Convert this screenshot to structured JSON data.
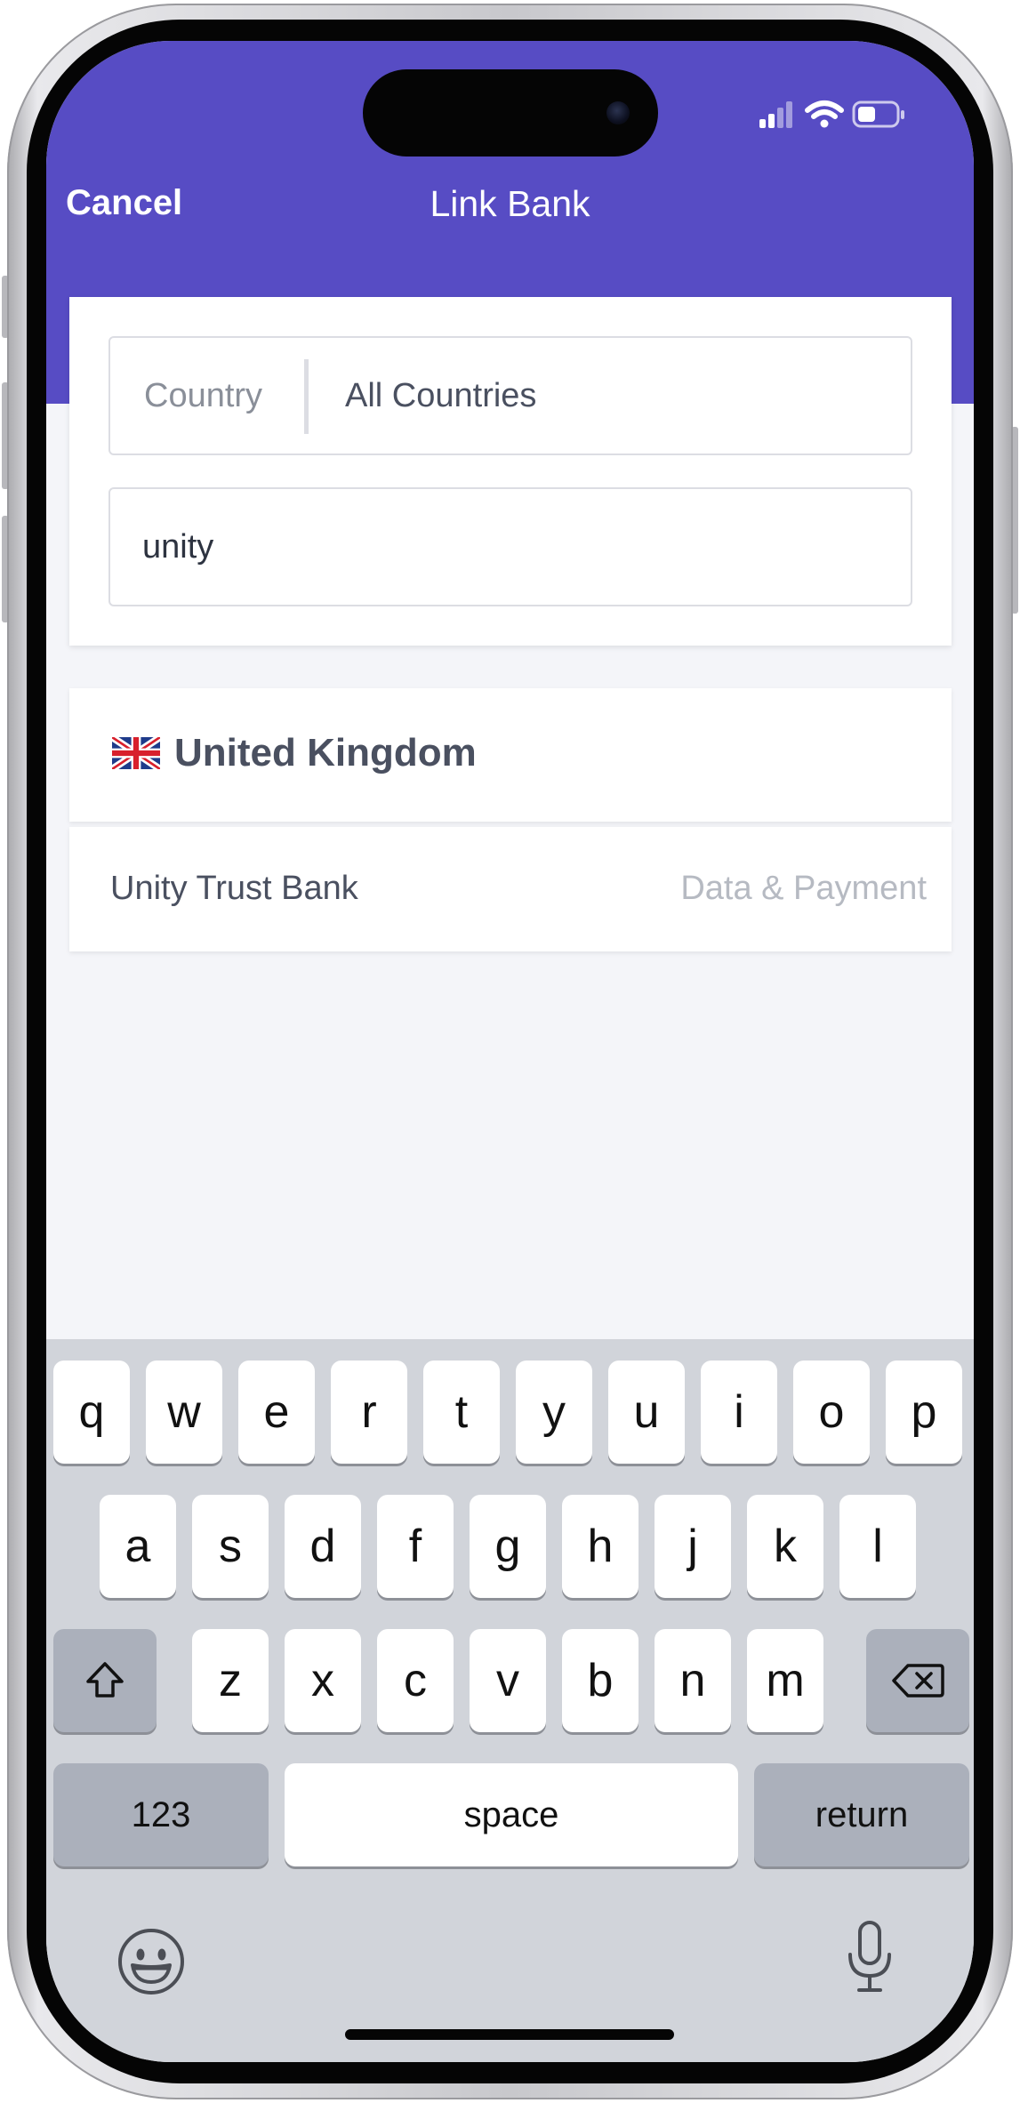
{
  "navbar": {
    "cancel_label": "Cancel",
    "title": "Link Bank"
  },
  "search": {
    "country_label": "Country",
    "country_value": "All Countries",
    "query_value": "unity"
  },
  "results": {
    "group": {
      "flag": "🇬🇧",
      "flag_icon": "uk-flag-icon",
      "country": "United Kingdom"
    },
    "items": [
      {
        "name": "Unity Trust Bank",
        "type": "Data & Payment"
      }
    ]
  },
  "keyboard": {
    "row1": [
      "q",
      "w",
      "e",
      "r",
      "t",
      "y",
      "u",
      "i",
      "o",
      "p"
    ],
    "row2": [
      "a",
      "s",
      "d",
      "f",
      "g",
      "h",
      "j",
      "k",
      "l"
    ],
    "row3": [
      "z",
      "x",
      "c",
      "v",
      "b",
      "n",
      "m"
    ],
    "numbers_label": "123",
    "space_label": "space",
    "return_label": "return",
    "shift_icon": "shift-icon",
    "backspace_icon": "backspace-icon",
    "emoji_icon": "emoji-icon",
    "mic_icon": "microphone-icon"
  },
  "status_bar": {
    "signal_icon": "cellular-signal-icon",
    "wifi_icon": "wifi-icon",
    "battery_icon": "battery-icon"
  },
  "colors": {
    "brand": "#574cc4",
    "background": "#f4f5f9",
    "keyboard": "#d1d4da"
  }
}
